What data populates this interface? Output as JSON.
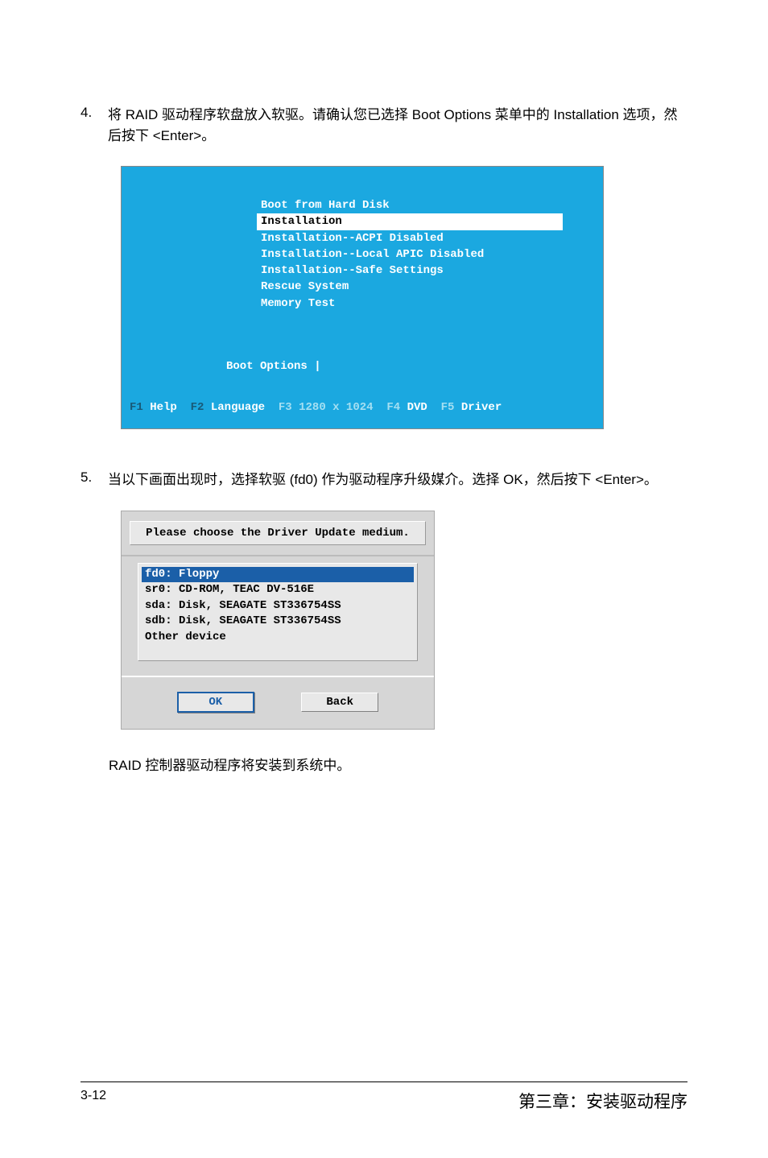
{
  "step4": {
    "num": "4.",
    "text": "将 RAID 驱动程序软盘放入软驱。请确认您已选择 Boot Options 菜单中的 Installation 选项，然后按下 <Enter>。"
  },
  "boot": {
    "items": [
      "Boot from Hard Disk",
      "Installation",
      "Installation--ACPI Disabled",
      "Installation--Local APIC Disabled",
      "Installation--Safe Settings",
      "Rescue System",
      "Memory Test"
    ],
    "options_label": "Boot Options |",
    "fkeys": {
      "f1": "F1",
      "f1l": "Help",
      "f2": "F2",
      "f2l": "Language",
      "f3": "F3",
      "f3l": "1280 x 1024",
      "f4": "F4",
      "f4l": "DVD",
      "f5": "F5",
      "f5l": "Driver"
    }
  },
  "step5": {
    "num": "5.",
    "text": "当以下画面出现时，选择软驱 (fd0) 作为驱动程序升级媒介。选择 OK，然后按下 <Enter>。"
  },
  "dialog": {
    "title": "Please choose the Driver Update medium.",
    "items": [
      "fd0: Floppy",
      "sr0: CD-ROM, TEAC DV-516E",
      "sda: Disk, SEAGATE ST336754SS",
      "sdb: Disk, SEAGATE ST336754SS",
      "Other device"
    ],
    "ok": "OK",
    "back": "Back"
  },
  "closing": "RAID 控制器驱动程序将安装到系统中。",
  "footer": {
    "page": "3-12",
    "chapter": "第三章：安装驱动程序"
  }
}
